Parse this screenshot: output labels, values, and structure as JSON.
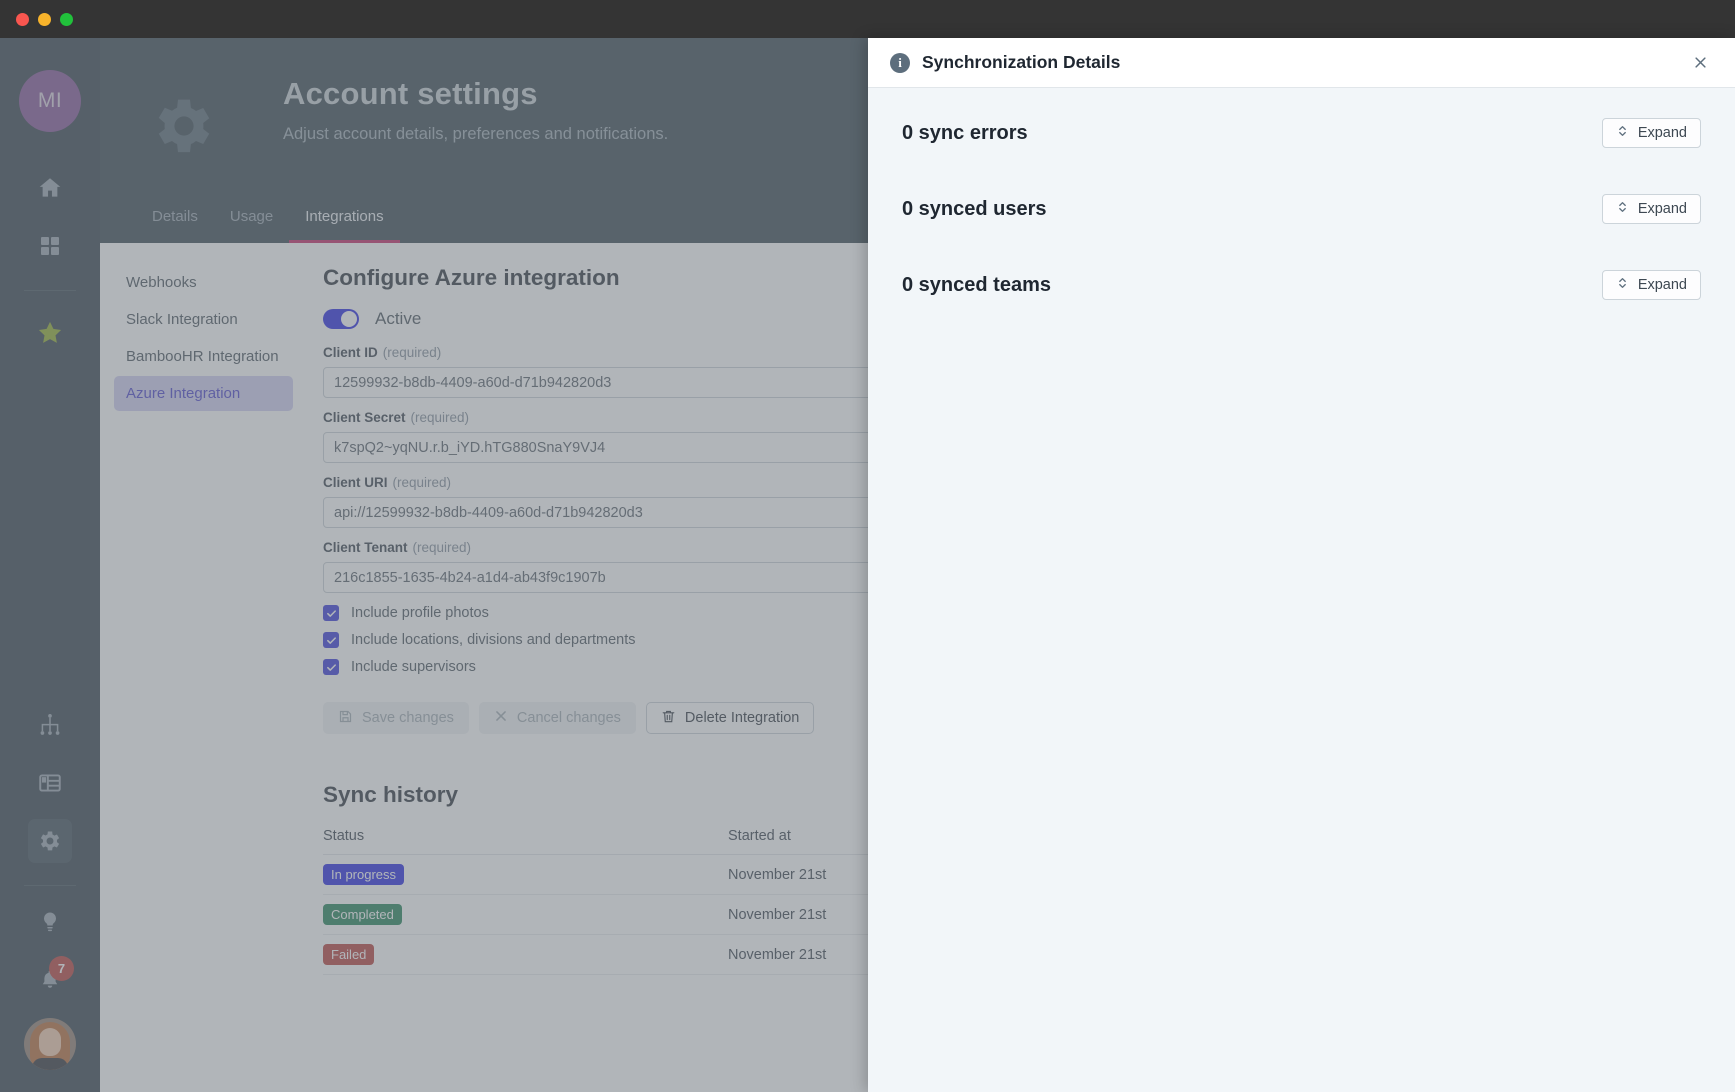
{
  "window": {
    "traffic_lights": [
      "close",
      "minimize",
      "zoom"
    ]
  },
  "rail": {
    "account_initials": "MI",
    "items": [
      {
        "name": "home",
        "icon": "home-icon"
      },
      {
        "name": "dashboard",
        "icon": "grid-icon"
      },
      {
        "name": "favorites",
        "icon": "star-icon"
      },
      {
        "name": "org-chart",
        "icon": "org-chart-icon"
      },
      {
        "name": "directory",
        "icon": "table-icon"
      },
      {
        "name": "settings",
        "icon": "gear-icon",
        "active": true
      },
      {
        "name": "tips",
        "icon": "lightbulb-icon"
      },
      {
        "name": "notifications",
        "icon": "bell-icon"
      }
    ],
    "notification_count": "7"
  },
  "header": {
    "icon": "gear-icon",
    "title": "Account settings",
    "subtitle": "Adjust account details, preferences and notifications.",
    "tabs": [
      {
        "label": "Details",
        "active": false
      },
      {
        "label": "Usage",
        "active": false
      },
      {
        "label": "Integrations",
        "active": true
      }
    ]
  },
  "settings_nav": {
    "items": [
      {
        "label": "Webhooks",
        "active": false
      },
      {
        "label": "Slack Integration",
        "active": false
      },
      {
        "label": "BambooHR Integration",
        "active": false
      },
      {
        "label": "Azure Integration",
        "active": true
      }
    ]
  },
  "form": {
    "title": "Configure Azure integration",
    "toggle": {
      "label": "Active",
      "on": true
    },
    "required_suffix": "(required)",
    "fields": [
      {
        "label": "Client ID",
        "required": "(required)",
        "value": "12599932-b8db-4409-a60d-d71b942820d3"
      },
      {
        "label": "Client Secret",
        "required": "(required)",
        "value": "k7spQ2~yqNU.r.b_iYD.hTG880SnaY9VJ4"
      },
      {
        "label": "Client URI",
        "required": "(required)",
        "value": "api://12599932-b8db-4409-a60d-d71b942820d3"
      },
      {
        "label": "Client Tenant",
        "required": "(required)",
        "value": "216c1855-1635-4b24-a1d4-ab43f9c1907b"
      }
    ],
    "checkboxes": [
      {
        "label": "Include profile photos",
        "checked": true
      },
      {
        "label": "Include locations, divisions and departments",
        "checked": true
      },
      {
        "label": "Include supervisors",
        "checked": true
      }
    ],
    "buttons": [
      {
        "label": "Save changes",
        "icon": "save-icon",
        "disabled": true
      },
      {
        "label": "Cancel changes",
        "icon": "close-icon",
        "disabled": true
      },
      {
        "label": "Delete Integration",
        "icon": "trash-icon",
        "disabled": false
      }
    ]
  },
  "sync_history": {
    "title": "Sync history",
    "columns": [
      "Status",
      "Started at"
    ],
    "rows": [
      {
        "status": "In progress",
        "status_kind": "inprogress",
        "started_at": "November 21st"
      },
      {
        "status": "Completed",
        "status_kind": "completed",
        "started_at": "November 21st"
      },
      {
        "status": "Failed",
        "status_kind": "failed",
        "started_at": "November 21st"
      }
    ]
  },
  "drawer": {
    "icon": "info-icon",
    "title": "Synchronization Details",
    "close_label": "×",
    "sections": [
      {
        "label": "0 sync errors",
        "button": "Expand"
      },
      {
        "label": "0 synced users",
        "button": "Expand"
      },
      {
        "label": "0 synced teams",
        "button": "Expand"
      }
    ]
  },
  "colors": {
    "accent_blue": "#1a1ae0",
    "tab_underline": "#c2185b",
    "rail_bg": "#283640",
    "header_bg": "#2d3c47",
    "drawer_bg": "#f2f6f9",
    "status_inprogress": "#1a1ae0",
    "status_completed": "#13794e",
    "status_failed": "#b3332f",
    "badge_red": "#b3332f",
    "nav_active_bg": "#cdcbf0",
    "nav_active_fg": "#3e36c9"
  }
}
